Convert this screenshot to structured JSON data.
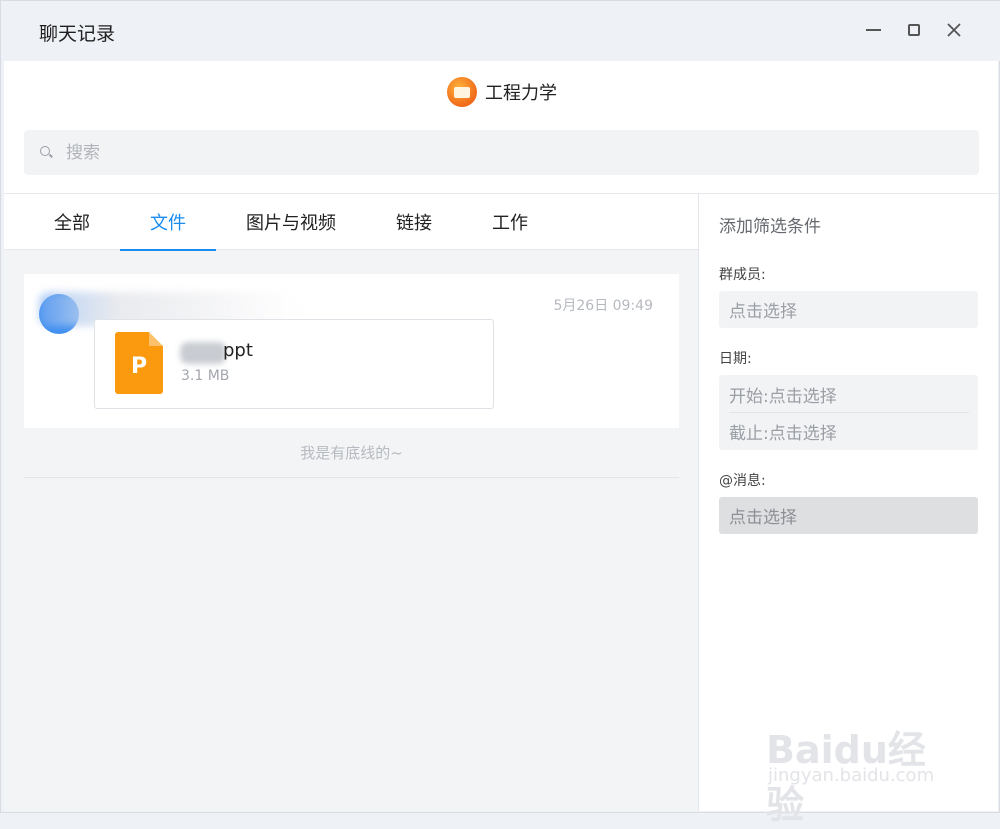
{
  "window": {
    "title": "聊天记录"
  },
  "header": {
    "group_name": "工程力学",
    "search_placeholder": "搜索"
  },
  "tabs": [
    {
      "label": "全部"
    },
    {
      "label": "文件"
    },
    {
      "label": "图片与视频"
    },
    {
      "label": "链接"
    },
    {
      "label": "工作"
    }
  ],
  "active_tab": "文件",
  "message": {
    "time": "5月26日 09:49",
    "file": {
      "icon_letter": "P",
      "name_visible": "ppt",
      "size": "3.1 MB"
    }
  },
  "end_text": "我是有底线的~",
  "filters": {
    "title": "添加筛选条件",
    "members_label": "群成员:",
    "members_placeholder": "点击选择",
    "date_label": "日期:",
    "start_placeholder": "开始:点击选择",
    "end_placeholder": "截止:点击选择",
    "mention_label": "@消息:",
    "mention_placeholder": "点击选择"
  },
  "watermark": {
    "logo": "Baidu经验",
    "url": "jingyan.baidu.com"
  },
  "colors": {
    "accent": "#1a8cf0",
    "ppt_icon": "#fb9a0f"
  }
}
